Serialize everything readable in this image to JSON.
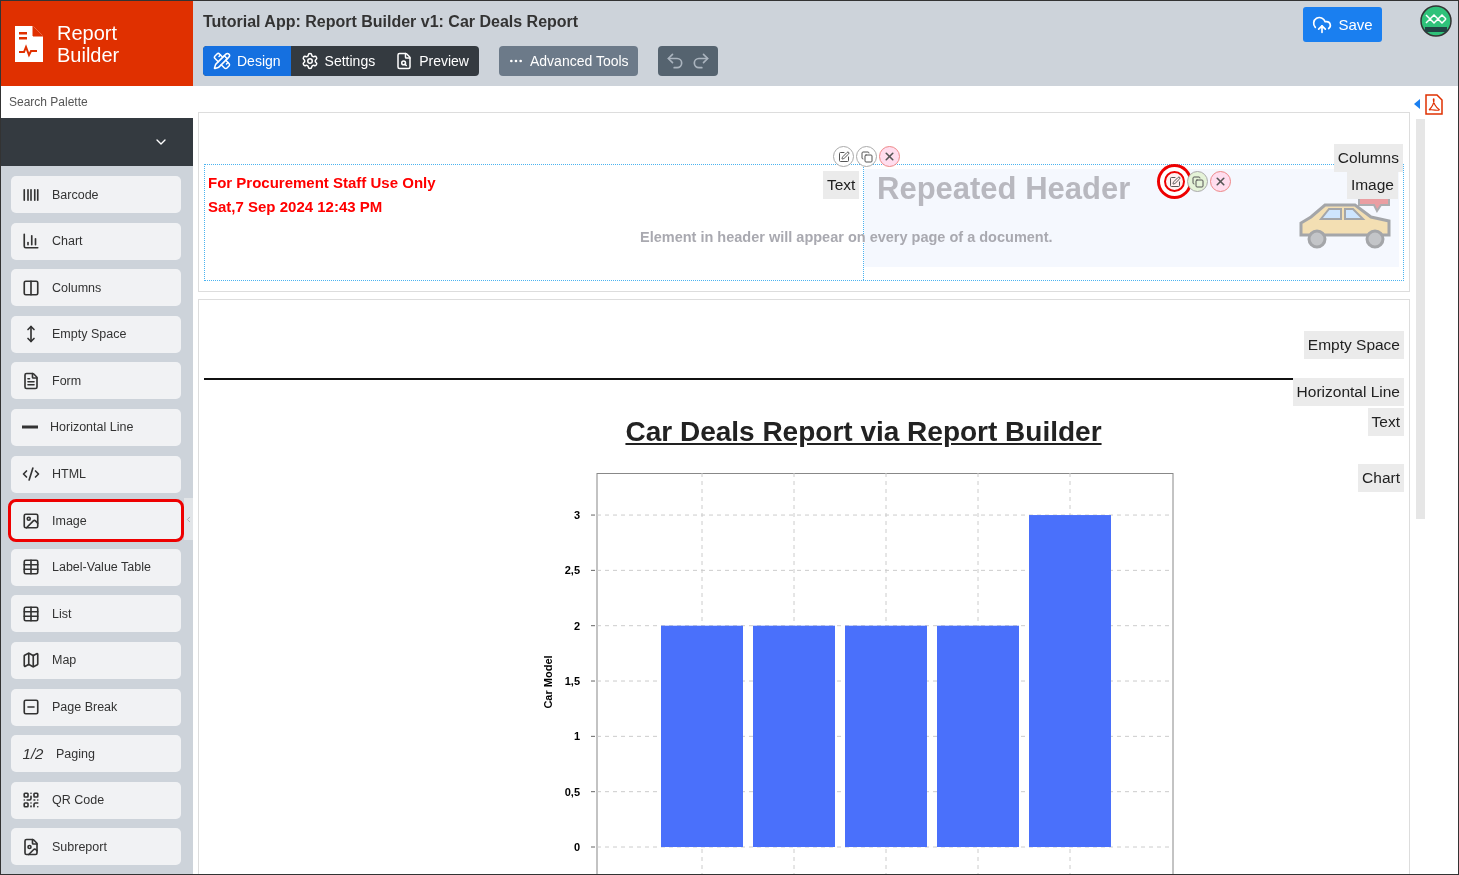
{
  "app": {
    "logo_text": "Report Builder",
    "title": "Tutorial App: Report Builder v1: Car Deals Report"
  },
  "toolbar": {
    "tabs": [
      {
        "label": "Design",
        "selected": true
      },
      {
        "label": "Settings",
        "selected": false
      },
      {
        "label": "Preview",
        "selected": false
      }
    ],
    "advanced": "Advanced Tools",
    "save": "Save"
  },
  "sidebar": {
    "search": {
      "placeholder": "Search Palette"
    },
    "palette": [
      {
        "label": "Barcode",
        "highlighted": false
      },
      {
        "label": "Chart",
        "highlighted": false
      },
      {
        "label": "Columns",
        "highlighted": false
      },
      {
        "label": "Empty Space",
        "highlighted": false
      },
      {
        "label": "Form",
        "highlighted": false
      },
      {
        "label": "Horizontal Line",
        "highlighted": false
      },
      {
        "label": "HTML",
        "highlighted": false
      },
      {
        "label": "Image",
        "highlighted": true
      },
      {
        "label": "Label-Value Table",
        "highlighted": false
      },
      {
        "label": "List",
        "highlighted": false
      },
      {
        "label": "Map",
        "highlighted": false
      },
      {
        "label": "Page Break",
        "highlighted": false
      },
      {
        "label": "Paging",
        "highlighted": false,
        "glyph": "1/2"
      },
      {
        "label": "QR Code",
        "highlighted": false
      },
      {
        "label": "Subreport",
        "highlighted": false
      }
    ]
  },
  "header": {
    "watermark": "Repeated Header",
    "hint": "Element in header will appear on every page of a document.",
    "lines": [
      "For Procurement Staff Use Only",
      "Sat,7 Sep 2024 12:43 PM"
    ],
    "text_tag": "Text",
    "columns_tag": "Columns",
    "image_tag": "Image",
    "text_controls": {
      "highlighted": false
    },
    "image_controls": {
      "highlighted": true
    }
  },
  "body": {
    "empty_space_tag": "Empty Space",
    "line_tag": "Horizontal Line",
    "title_tag": "Text",
    "title": "Car Deals Report via Report Builder",
    "chart_tag": "Chart",
    "chart_data": {
      "type": "bar",
      "grid": true,
      "ylabel": "Car Model",
      "ylim": [
        0,
        3.38
      ],
      "yticks": [
        0,
        {
          "value": 0.5,
          "label": "0,5"
        },
        1,
        {
          "value": 1.5,
          "label": "1,5"
        },
        2,
        {
          "value": 2.5,
          "label": "2,5"
        },
        3
      ],
      "series": [
        {
          "color": "#4a70fb",
          "values": [
            2,
            2,
            2,
            2,
            3
          ]
        }
      ]
    }
  }
}
